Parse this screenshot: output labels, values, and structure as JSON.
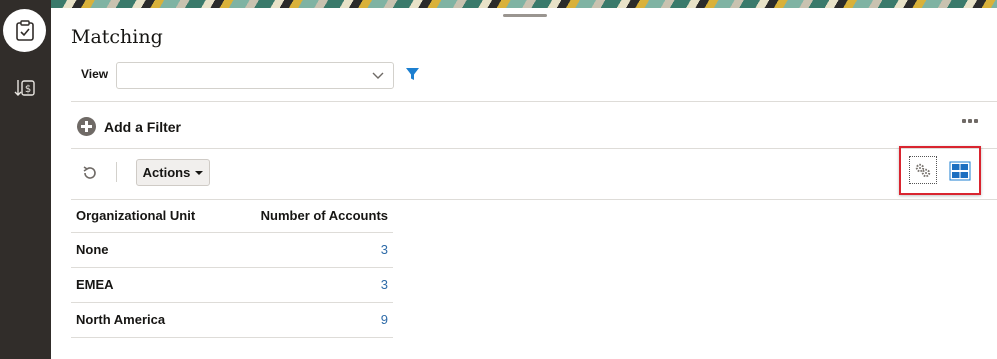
{
  "page": {
    "title": "Matching"
  },
  "nav": {
    "items": [
      {
        "icon": "clipboard-check-icon",
        "active": true
      },
      {
        "icon": "currency-exchange-icon",
        "active": false
      }
    ]
  },
  "view": {
    "label": "View",
    "value": ""
  },
  "filters": {
    "add_label": "Add a Filter"
  },
  "toolbar": {
    "actions_label": "Actions"
  },
  "colors": {
    "accent": "#2e6ba8",
    "highlight": "#d9242f",
    "rail": "#312d2a"
  },
  "table": {
    "columns": [
      "Organizational Unit",
      "Number of Accounts"
    ],
    "rows": [
      {
        "unit": "None",
        "count": "3"
      },
      {
        "unit": "EMEA",
        "count": "3"
      },
      {
        "unit": "North America",
        "count": "9"
      }
    ]
  }
}
